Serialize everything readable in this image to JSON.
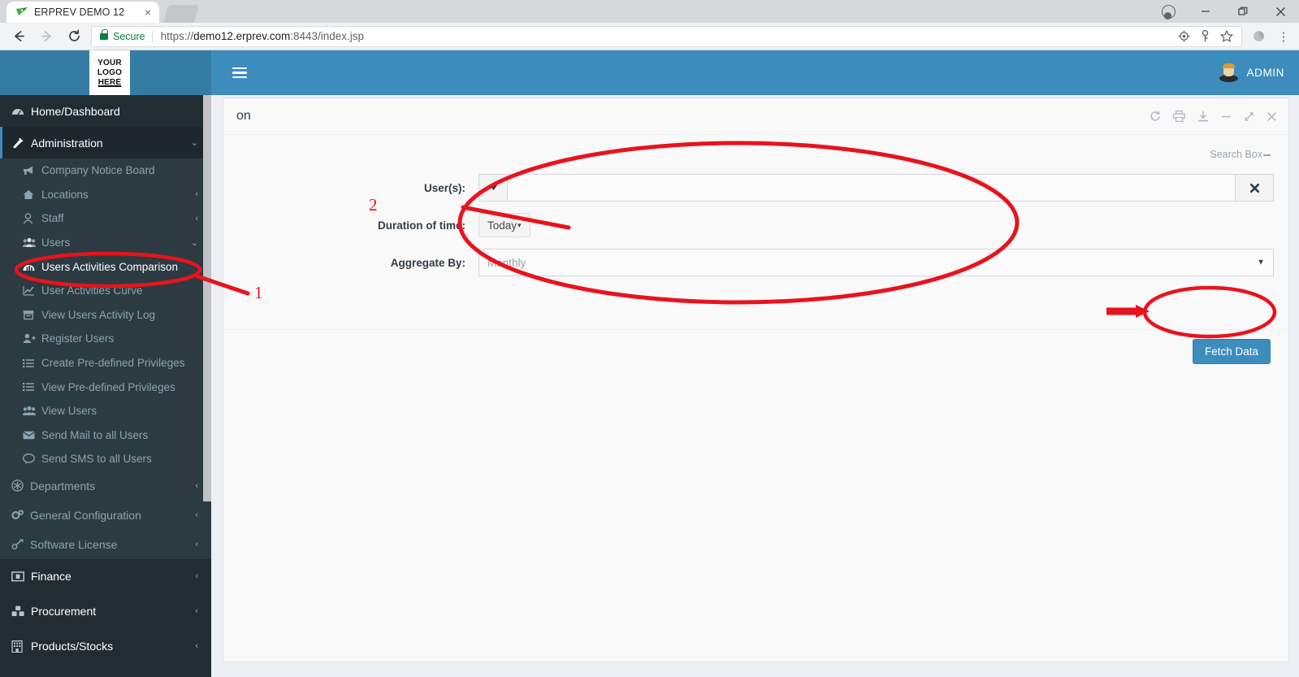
{
  "browser": {
    "tab_title": "ERPREV DEMO 12",
    "tab_close": "×",
    "security_label": "Secure",
    "url_scheme": "https://",
    "url_host": "demo12.erprev.com",
    "url_path": ":8443/index.jsp",
    "window_minimize": "—",
    "window_maximize": "❐",
    "window_close": "✕",
    "menu_glyph": "⋮"
  },
  "app": {
    "logo": {
      "line1": "YOUR",
      "line2": "LOGO",
      "line3": "HERE"
    },
    "user_label": "ADMIN"
  },
  "sidebar": {
    "items": [
      {
        "label": "Home/Dashboard",
        "icon": "dashboard-icon",
        "glyph": "◔",
        "arrow": ""
      },
      {
        "label": "Administration",
        "icon": "wrench-icon",
        "glyph": "✒",
        "arrow": "⌄"
      },
      {
        "label": "Company Notice Board",
        "icon": "megaphone-icon",
        "glyph": "📣",
        "arrow": ""
      },
      {
        "label": "Locations",
        "icon": "home-icon",
        "glyph": "🏠",
        "arrow": "‹"
      },
      {
        "label": "Staff",
        "icon": "user-icon",
        "glyph": "○",
        "arrow": "‹"
      },
      {
        "label": "Users",
        "icon": "users-icon",
        "glyph": "👥",
        "arrow": "⌄"
      },
      {
        "label": "Users Activities Comparison",
        "icon": "bar-chart-icon",
        "glyph": "📊",
        "arrow": ""
      },
      {
        "label": "User Activities Curve",
        "icon": "line-chart-icon",
        "glyph": "📈",
        "arrow": ""
      },
      {
        "label": "View Users Activity Log",
        "icon": "archive-icon",
        "glyph": "▤",
        "arrow": ""
      },
      {
        "label": "Register Users",
        "icon": "user-plus-icon",
        "glyph": "☺",
        "arrow": ""
      },
      {
        "label": "Create Pre-defined Privileges",
        "icon": "list-icon",
        "glyph": "☰",
        "arrow": ""
      },
      {
        "label": "View Pre-defined Privileges",
        "icon": "list-icon",
        "glyph": "☰",
        "arrow": ""
      },
      {
        "label": "View Users",
        "icon": "users-icon",
        "glyph": "👥",
        "arrow": ""
      },
      {
        "label": "Send Mail to all Users",
        "icon": "envelope-icon",
        "glyph": "✉",
        "arrow": ""
      },
      {
        "label": "Send SMS to all Users",
        "icon": "comment-icon",
        "glyph": "💬",
        "arrow": ""
      },
      {
        "label": "Departments",
        "icon": "asterisk-circle-icon",
        "glyph": "✳",
        "arrow": "‹"
      },
      {
        "label": "General Configuration",
        "icon": "gears-icon",
        "glyph": "⚙",
        "arrow": "‹"
      },
      {
        "label": "Software License",
        "icon": "link-icon",
        "glyph": "🔗",
        "arrow": "‹"
      },
      {
        "label": "Finance",
        "icon": "money-icon",
        "glyph": "▣",
        "arrow": "‹"
      },
      {
        "label": "Procurement",
        "icon": "cubes-icon",
        "glyph": "❖",
        "arrow": "‹"
      },
      {
        "label": "Products/Stocks",
        "icon": "building-icon",
        "glyph": "▦",
        "arrow": "‹"
      }
    ]
  },
  "panel": {
    "title_visible_fragment": "on",
    "tools": [
      {
        "name": "refresh-icon",
        "glyph": "⟳"
      },
      {
        "name": "print-icon",
        "glyph": "⎙"
      },
      {
        "name": "download-icon",
        "glyph": "⤓"
      },
      {
        "name": "minimize-icon",
        "glyph": "—"
      },
      {
        "name": "expand-icon",
        "glyph": "⤢"
      },
      {
        "name": "close-icon",
        "glyph": "✕"
      }
    ],
    "search_box_label": "Search Box"
  },
  "form": {
    "users": {
      "label": "User(s):",
      "value": "",
      "placeholder": "",
      "dropdown_glyph": "▼",
      "clear_glyph": "✖"
    },
    "duration": {
      "label": "Duration of time:",
      "value": "Today",
      "caret_glyph": "▾"
    },
    "aggregate": {
      "label": "Aggregate By:",
      "value": "Monthly",
      "caret_glyph": "▼"
    },
    "submit_label": "Fetch Data"
  },
  "annotations": {
    "marker_1": "1",
    "marker_2": "2",
    "color": "#e8131e"
  },
  "colors": {
    "header_blue": "#3c8dbc",
    "header_blue_dark": "#357ca5",
    "sidebar_dark": "#222d32",
    "sidebar_submenu": "#2c3b41",
    "sidebar_active": "#1e282c",
    "content_bg": "#ecf0f5",
    "annotation_red": "#e8131e",
    "secure_green": "#0b8043"
  }
}
